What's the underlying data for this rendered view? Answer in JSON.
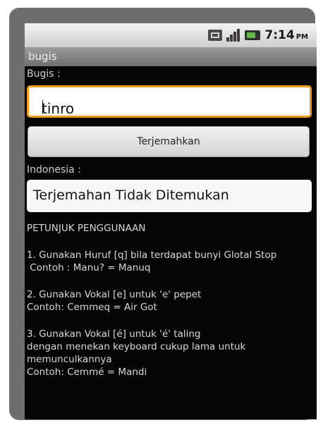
{
  "status_bar": {
    "time": "7:14",
    "ampm": "PM",
    "icons": [
      "sync-icon",
      "signal-icon",
      "battery-icon"
    ]
  },
  "app": {
    "title": "bugis"
  },
  "source": {
    "label": "Bugis :",
    "value": "tinro"
  },
  "translate_button": {
    "label": "Terjemahkan"
  },
  "target": {
    "label": "Indonesia :",
    "value": "Terjemahan Tidak Ditemukan"
  },
  "instructions": {
    "heading": "PETUNJUK PENGGUNAAN",
    "item1_line1": "1. Gunakan Huruf [q] bila terdapat bunyi Glotal Stop",
    "item1_example": " Contoh : Manu? = Manuq",
    "item2_line1": "2. Gunakan Vokal [e] untuk 'e' pepet",
    "item2_example": "Contoh: Cemmeq = Air Got",
    "item3_line1": "3. Gunakan Vokal [é] untuk 'é' taling",
    "item3_line2": "dengan menekan keyboard cukup lama untuk memunculkannya",
    "item3_example": "Contoh: Cemmé = Mandi"
  }
}
